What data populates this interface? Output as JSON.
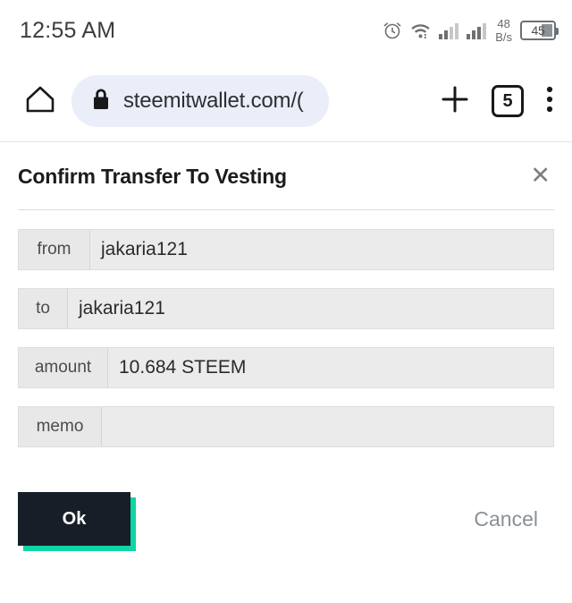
{
  "status_bar": {
    "clock": "12:55 AM",
    "alarm_icon": "alarm-clock-icon",
    "wifi_icon": "wifi-icon",
    "signal_one_icon": "signal-bars-sim1-icon",
    "signal_two_icon": "signal-bars-sim2-icon",
    "data_rate_value": "48",
    "data_rate_unit": "B/s",
    "battery_level": "45"
  },
  "browser_bar": {
    "home_icon": "home-icon",
    "lock_icon": "lock-icon",
    "url": "steemitwallet.com/(",
    "new_tab_icon": "plus-icon",
    "tab_count": "5",
    "menu_icon": "more-vertical-icon"
  },
  "modal": {
    "title": "Confirm Transfer To Vesting",
    "close_icon": "close-icon",
    "fields": [
      {
        "label": "from",
        "value": "jakaria121",
        "label_width": "80px"
      },
      {
        "label": "to",
        "value": "jakaria121",
        "label_width": "55px"
      },
      {
        "label": "amount",
        "value": "10.684 STEEM",
        "label_width": "100px"
      },
      {
        "label": "memo",
        "value": "",
        "label_width": "93px"
      }
    ],
    "ok_label": "Ok",
    "cancel_label": "Cancel",
    "accent_color": "#10d4a3",
    "ok_bg_color": "#171e28"
  }
}
